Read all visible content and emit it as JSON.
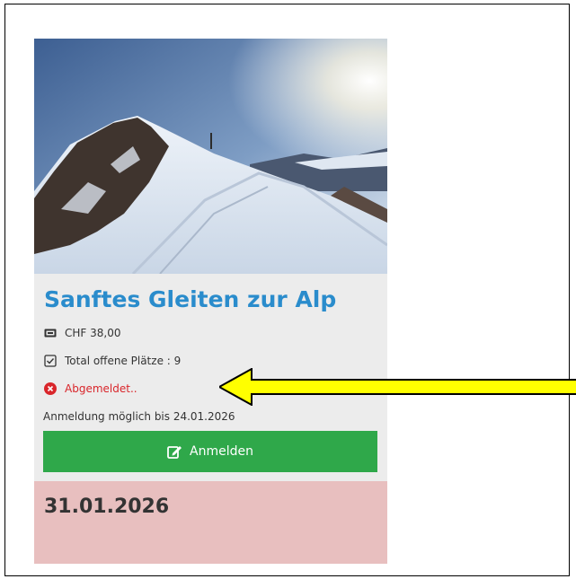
{
  "event": {
    "title": "Sanftes Gleiten zur Alp",
    "price": "CHF 38,00",
    "places": "Total offene Plätze : 9",
    "status": "Abgemeldet..",
    "deadline": "Anmeldung möglich bis 24.01.2026",
    "button_label": "Anmelden",
    "date": "31.01.2026"
  },
  "icons": {
    "price": "ticket-icon",
    "places": "checkbox-icon",
    "status": "error-circle-icon",
    "button": "edit-icon"
  },
  "colors": {
    "title": "#2a8ccc",
    "status": "#d9262b",
    "button": "#2fa84a",
    "date_box": "#e8bfbf",
    "arrow": "#ffff00"
  }
}
